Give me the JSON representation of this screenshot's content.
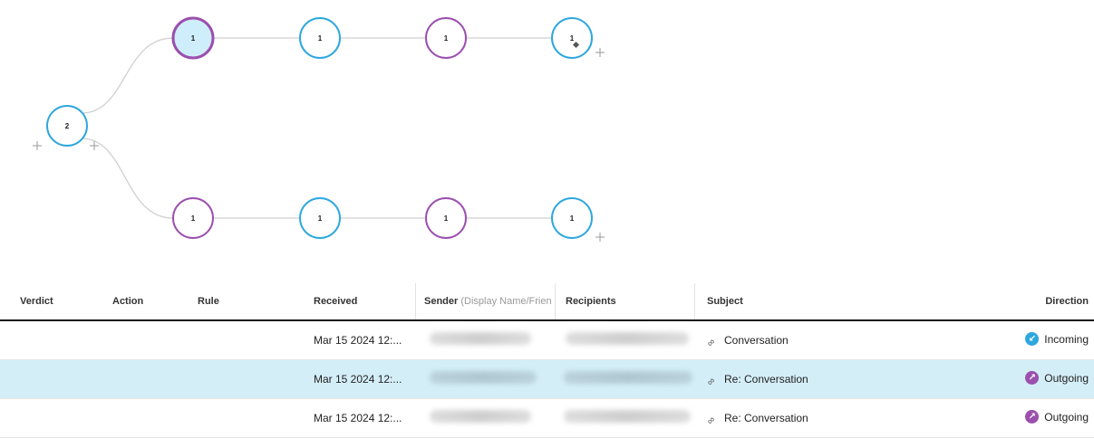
{
  "graph": {
    "colors": {
      "blue": "#2ea7de",
      "purple": "#9b4fae",
      "selected_fill": "#cfeefc",
      "edge": "#cfcfcf"
    },
    "nodes": [
      {
        "id": "root",
        "count": "2",
        "color": "blue"
      },
      {
        "id": "a1",
        "count": "1",
        "color": "purple",
        "selected": true
      },
      {
        "id": "a2",
        "count": "1",
        "color": "blue"
      },
      {
        "id": "a3",
        "count": "1",
        "color": "purple"
      },
      {
        "id": "a4",
        "count": "1",
        "color": "blue",
        "marker": "diamond"
      },
      {
        "id": "b1",
        "count": "1",
        "color": "purple"
      },
      {
        "id": "b2",
        "count": "1",
        "color": "blue"
      },
      {
        "id": "b3",
        "count": "1",
        "color": "purple"
      },
      {
        "id": "b4",
        "count": "1",
        "color": "blue"
      }
    ]
  },
  "table": {
    "headers": {
      "verdict": "Verdict",
      "action": "Action",
      "rule": "Rule",
      "received": "Received",
      "sender": "Sender",
      "sender_sub": "(Display Name/Friend",
      "recipients": "Recipients",
      "subject": "Subject",
      "direction": "Direction"
    },
    "rows": [
      {
        "received": "Mar 15 2024 12:...",
        "subject": "Conversation",
        "direction": "Incoming",
        "direction_color": "#2ea7de",
        "selected": false
      },
      {
        "received": "Mar 15 2024 12:...",
        "subject": "Re: Conversation",
        "direction": "Outgoing",
        "direction_color": "#9b4fae",
        "selected": true
      },
      {
        "received": "Mar 15 2024 12:...",
        "subject": "Re: Conversation",
        "direction": "Outgoing",
        "direction_color": "#9b4fae",
        "selected": false
      }
    ]
  }
}
